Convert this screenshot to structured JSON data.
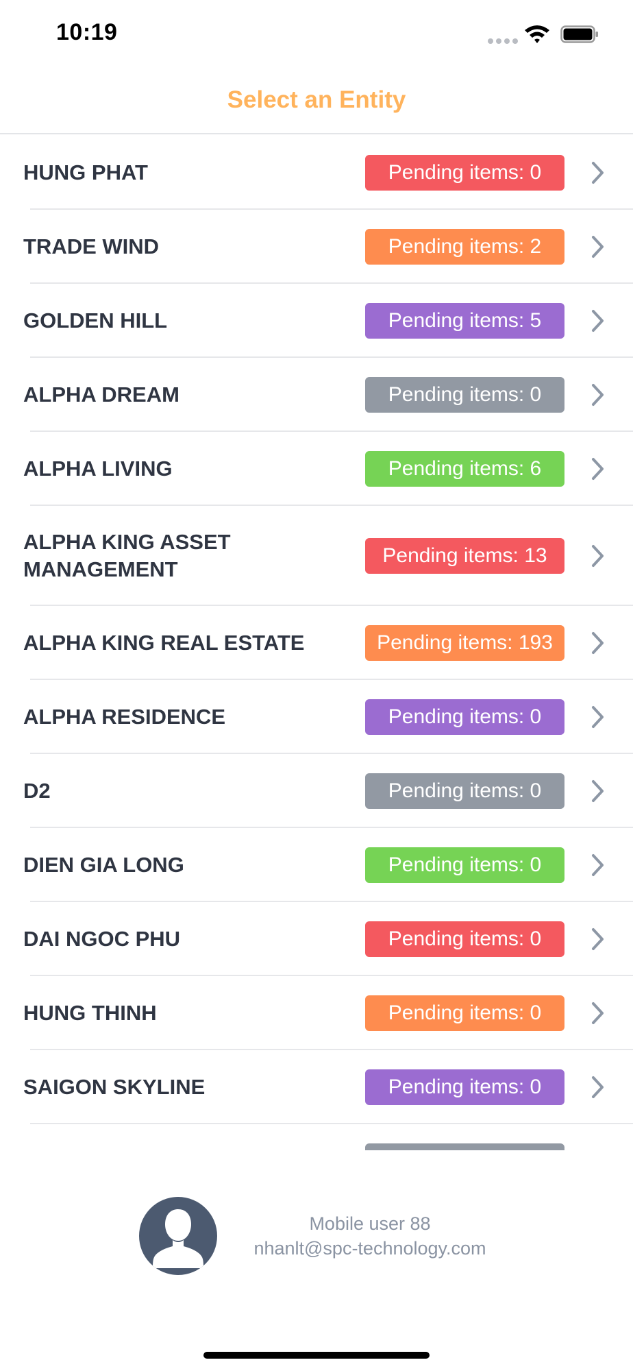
{
  "status_bar": {
    "time": "10:19"
  },
  "nav": {
    "title": "Select an Entity"
  },
  "colors": {
    "title": "#ffb35c",
    "red": "#f4595f",
    "orange": "#fe8c4f",
    "purple": "#9b6cd1",
    "gray": "#9299a3",
    "green": "#76d355"
  },
  "entities": [
    {
      "name": "HUNG PHAT",
      "badge": "Pending items: 0",
      "color": "#f4595f"
    },
    {
      "name": "TRADE WIND",
      "badge": "Pending items: 2",
      "color": "#fe8c4f"
    },
    {
      "name": "GOLDEN HILL",
      "badge": "Pending items: 5",
      "color": "#9b6cd1"
    },
    {
      "name": "ALPHA DREAM",
      "badge": "Pending items: 0",
      "color": "#9299a3"
    },
    {
      "name": "ALPHA LIVING",
      "badge": "Pending items: 6",
      "color": "#76d355"
    },
    {
      "name": "ALPHA KING ASSET MANAGEMENT",
      "badge": "Pending items: 13",
      "color": "#f4595f"
    },
    {
      "name": "ALPHA KING REAL ESTATE",
      "badge": "Pending items: 193",
      "color": "#fe8c4f"
    },
    {
      "name": "ALPHA RESIDENCE",
      "badge": "Pending items: 0",
      "color": "#9b6cd1"
    },
    {
      "name": "D2",
      "badge": "Pending items: 0",
      "color": "#9299a3"
    },
    {
      "name": "DIEN GIA LONG",
      "badge": "Pending items: 0",
      "color": "#76d355"
    },
    {
      "name": "DAI NGOC PHU",
      "badge": "Pending items: 0",
      "color": "#f4595f"
    },
    {
      "name": "HUNG THINH",
      "badge": "Pending items: 0",
      "color": "#fe8c4f"
    },
    {
      "name": "SAIGON SKYLINE",
      "badge": "Pending items: 0",
      "color": "#9b6cd1"
    },
    {
      "name": "",
      "badge": "",
      "color": "#9299a3"
    }
  ],
  "user": {
    "name": "Mobile user 88",
    "email": "nhanlt@spc-technology.com"
  },
  "icons": {
    "row_chevron": "chevron-right-icon",
    "avatar": "user-silhouette-icon",
    "wifi": "wifi-icon",
    "battery": "battery-icon"
  }
}
